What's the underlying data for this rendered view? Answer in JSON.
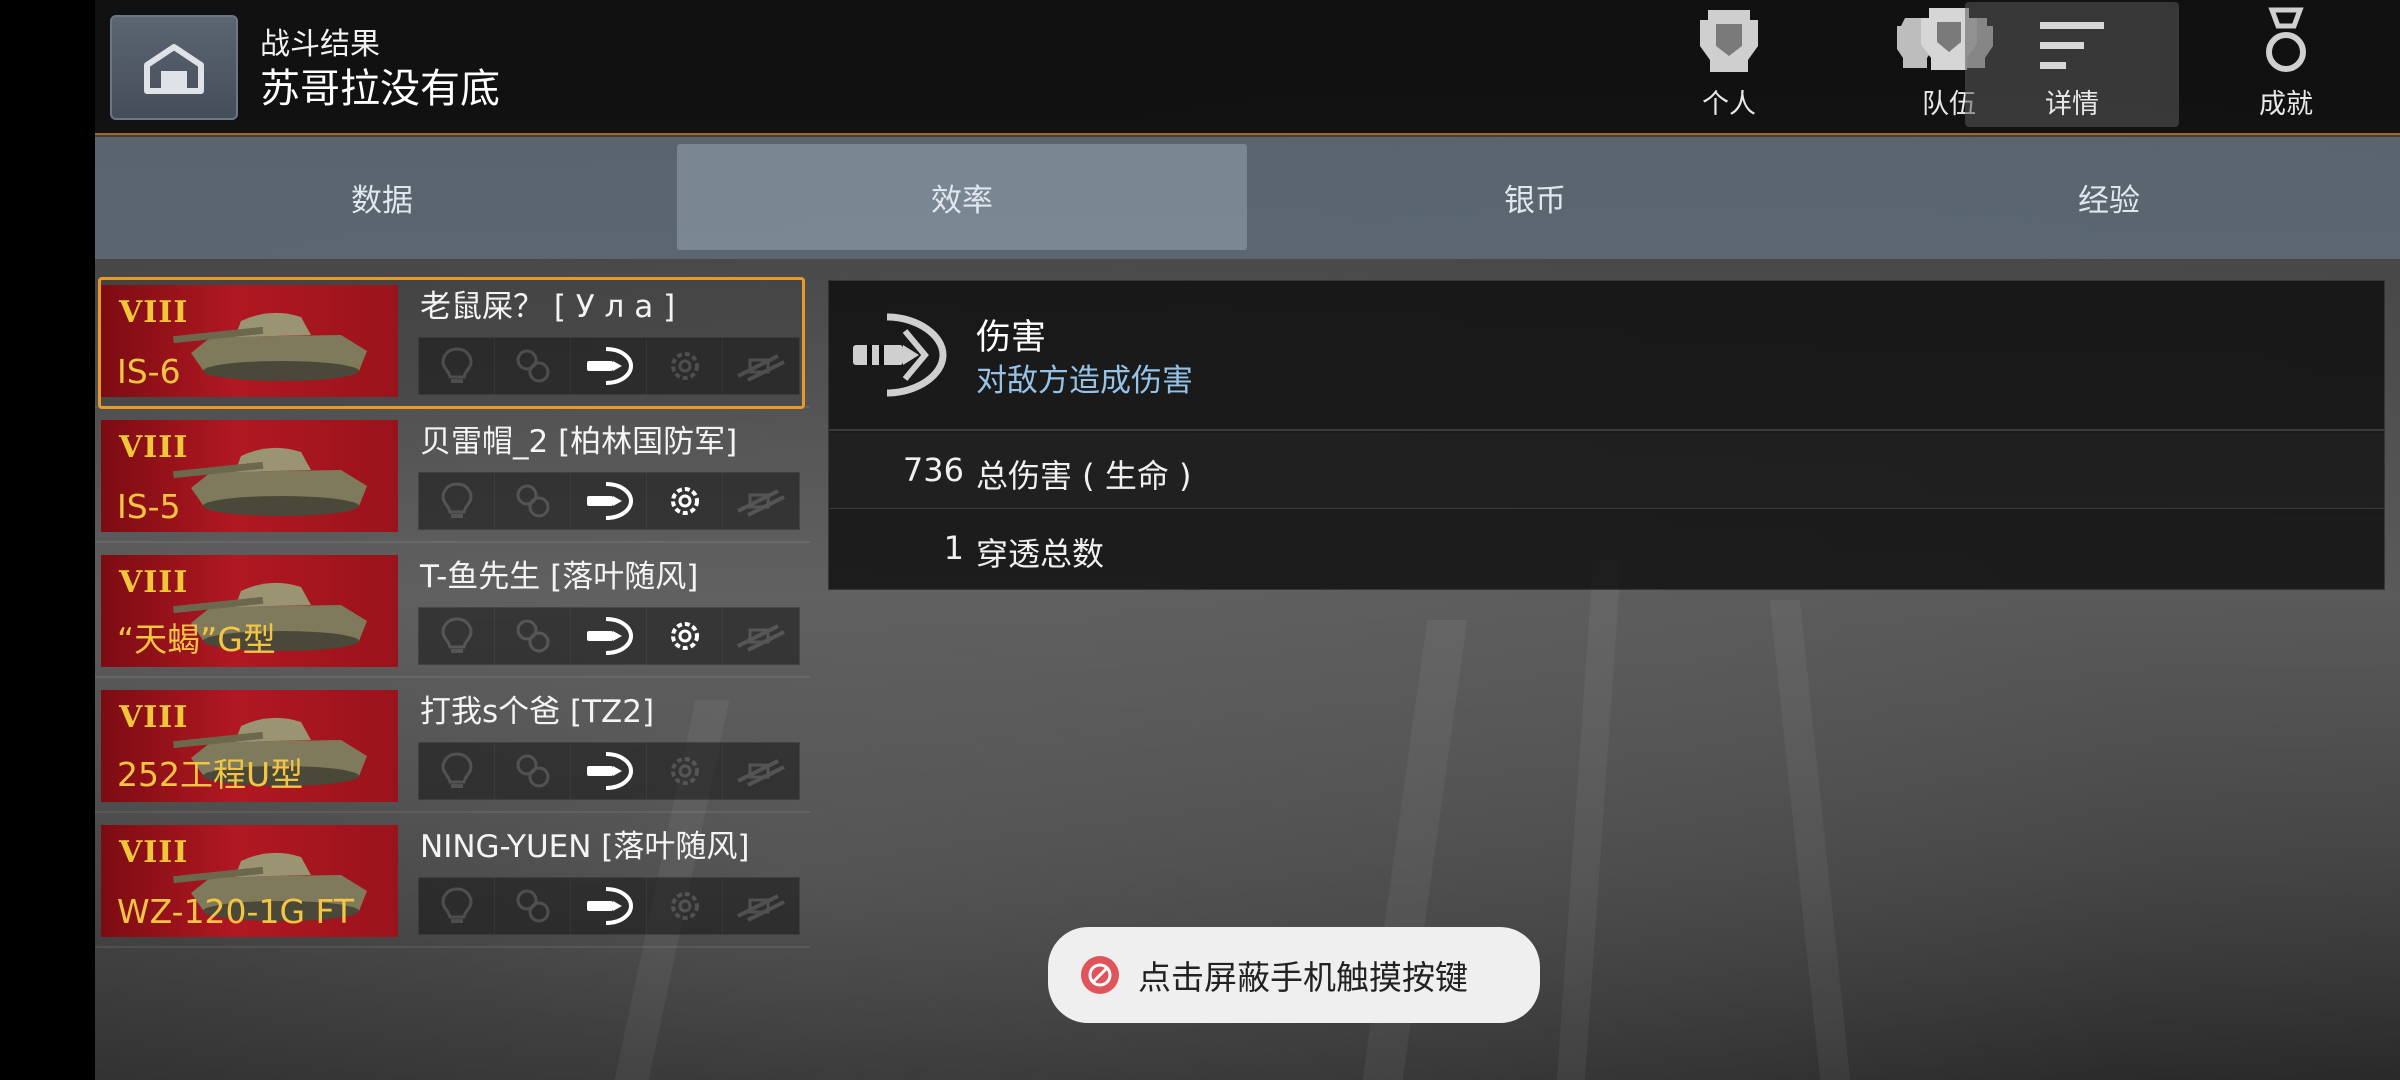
{
  "header": {
    "home_icon": "hangar-icon",
    "title_small": "战斗结果",
    "title_big": "苏哥拉没有底",
    "tabs": [
      {
        "label": "个人",
        "icon": "helmet-icon"
      },
      {
        "label": "队伍",
        "icon": "team-icon"
      },
      {
        "label": "详情",
        "icon": "details-icon",
        "active": true
      },
      {
        "label": "成就",
        "icon": "medal-icon"
      }
    ]
  },
  "subtabs": [
    {
      "label": "数据"
    },
    {
      "label": "效率",
      "active": true
    },
    {
      "label": "银币"
    },
    {
      "label": "经验"
    }
  ],
  "players": [
    {
      "tier": "VIII",
      "tank": "IS-6",
      "name": "老鼠屎？ [ У л а ]",
      "selected": true,
      "icons_on": [
        false,
        false,
        true,
        false,
        false
      ]
    },
    {
      "tier": "VIII",
      "tank": "IS-5",
      "name": "贝雷帽_2 [柏林国防军]",
      "selected": false,
      "icons_on": [
        false,
        false,
        true,
        true,
        false
      ]
    },
    {
      "tier": "VIII",
      "tank": "“天蝎”G型",
      "name": "T-鱼先生 [落叶随风]",
      "selected": false,
      "icons_on": [
        false,
        false,
        true,
        true,
        false
      ]
    },
    {
      "tier": "VIII",
      "tank": "252工程U型",
      "name": "打我s个爸 [TZ2]",
      "selected": false,
      "icons_on": [
        false,
        false,
        true,
        false,
        false
      ]
    },
    {
      "tier": "VIII",
      "tank": "WZ-120-1G FT",
      "name": "NING-YUEN [落叶随风]",
      "selected": false,
      "icons_on": [
        false,
        false,
        true,
        false,
        false
      ]
    }
  ],
  "detail": {
    "icon": "damage-shell-icon",
    "title": "伤害",
    "subtitle": "对敌方造成伤害",
    "stats": [
      {
        "value": "736",
        "label": "总伤害 ( 生命 )"
      },
      {
        "value": "1",
        "label": "穿透总数"
      }
    ]
  },
  "toast": {
    "icon": "block-icon",
    "text": "点击屏蔽手机触摸按键"
  },
  "colors": {
    "accent_orange": "#e69a2b",
    "tank_gold": "#f4c443",
    "card_red": "#b11822",
    "subtitle_blue": "#95c3e8",
    "subtab_bar": "#5f6c7a"
  }
}
